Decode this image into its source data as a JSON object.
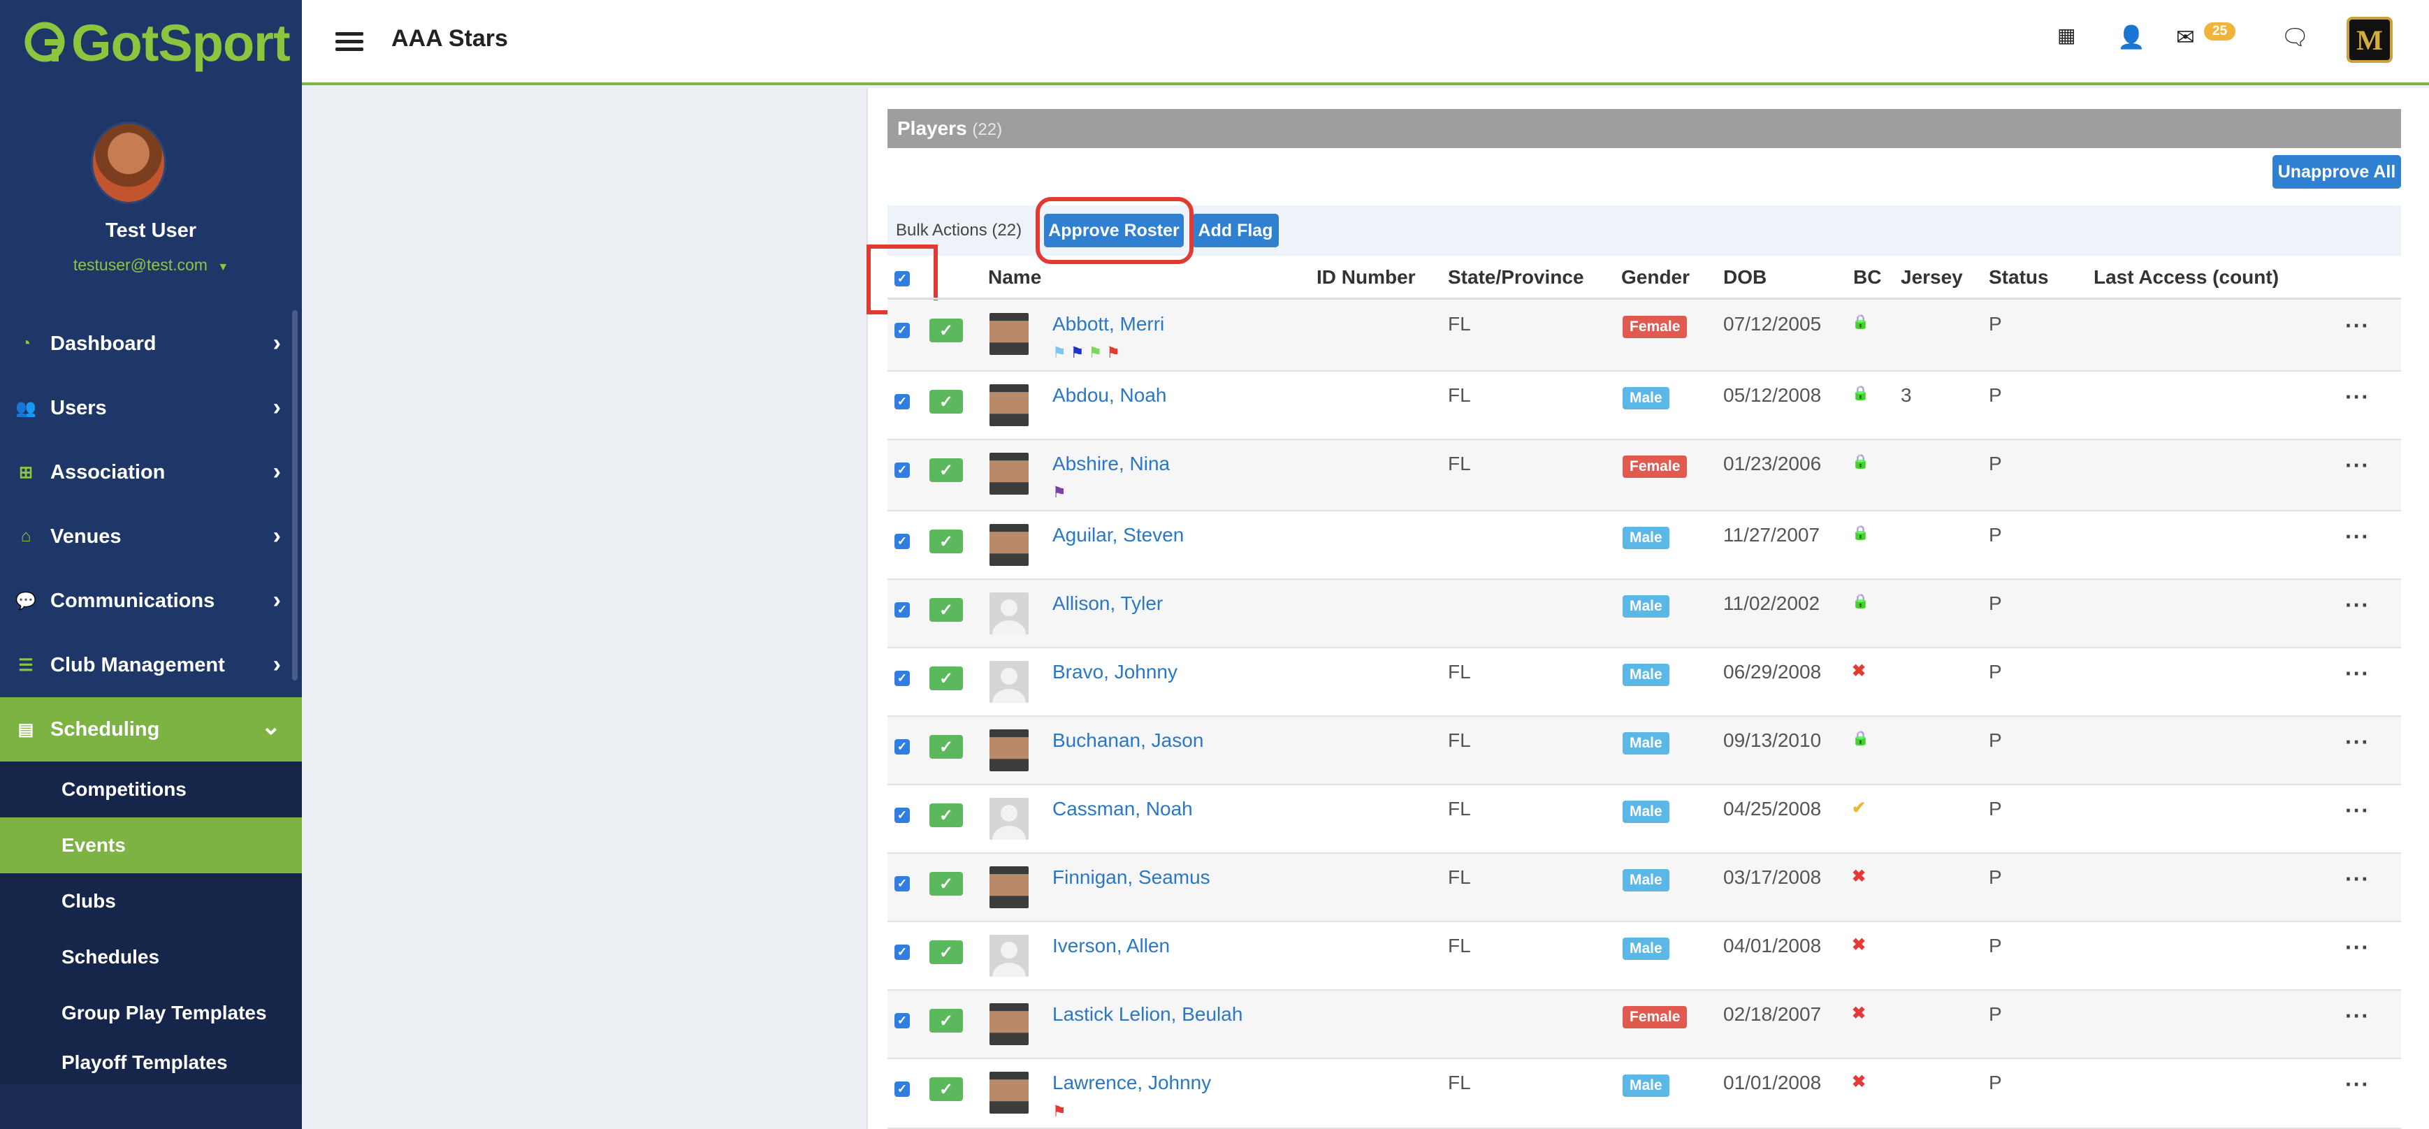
{
  "brand": {
    "logo_text": "GotSport",
    "accent": "#8cc63f",
    "sidebar_bg": "#1e3768"
  },
  "user": {
    "name": "Test User",
    "email": "testuser@test.com"
  },
  "nav": [
    {
      "label": "Dashboard",
      "icon": "dashboard-icon"
    },
    {
      "label": "Users",
      "icon": "users-icon"
    },
    {
      "label": "Association",
      "icon": "sitemap-icon"
    },
    {
      "label": "Venues",
      "icon": "home-icon"
    },
    {
      "label": "Communications",
      "icon": "chat-icon"
    },
    {
      "label": "Club Management",
      "icon": "list-icon"
    },
    {
      "label": "Scheduling",
      "icon": "calendar-list-icon"
    }
  ],
  "subnav": [
    "Competitions",
    "Events",
    "Clubs",
    "Schedules",
    "Group Play Templates",
    "Playoff Templates"
  ],
  "topbar": {
    "team_title": "AAA Stars",
    "mail_count": "25"
  },
  "players": {
    "title": "Players",
    "count": "(22)",
    "unapprove_all": "Unapprove All",
    "bulk_label": "Bulk Actions (22)",
    "approve_roster": "Approve Roster",
    "add_flag": "Add Flag",
    "columns": [
      "Name",
      "ID Number",
      "State/Province",
      "Gender",
      "DOB",
      "BC",
      "Jersey",
      "Status",
      "Last Access (count)"
    ],
    "rows": [
      {
        "name": "Abbott, Merri",
        "state": "FL",
        "gender": "Female",
        "dob": "07/12/2005",
        "bc": "lock",
        "jersey": "",
        "status": "P",
        "flags": [
          "#7fc4ec",
          "#1f2fc9",
          "#7ed957",
          "#e53935"
        ],
        "photo": "photo"
      },
      {
        "name": "Abdou, Noah",
        "state": "FL",
        "gender": "Male",
        "dob": "05/12/2008",
        "bc": "lock",
        "jersey": "3",
        "status": "P",
        "flags": [],
        "photo": "photo"
      },
      {
        "name": "Abshire, Nina",
        "state": "FL",
        "gender": "Female",
        "dob": "01/23/2006",
        "bc": "lock",
        "jersey": "",
        "status": "P",
        "flags": [
          "#7b3fa6"
        ],
        "photo": "photo"
      },
      {
        "name": "Aguilar, Steven",
        "state": "",
        "gender": "Male",
        "dob": "11/27/2007",
        "bc": "lock",
        "jersey": "",
        "status": "P",
        "flags": [],
        "photo": "photo"
      },
      {
        "name": "Allison, Tyler",
        "state": "",
        "gender": "Male",
        "dob": "11/02/2002",
        "bc": "lock",
        "jersey": "",
        "status": "P",
        "flags": [],
        "photo": "placeholder"
      },
      {
        "name": "Bravo, Johnny",
        "state": "FL",
        "gender": "Male",
        "dob": "06/29/2008",
        "bc": "x",
        "jersey": "",
        "status": "P",
        "flags": [],
        "photo": "placeholder"
      },
      {
        "name": "Buchanan, Jason",
        "state": "FL",
        "gender": "Male",
        "dob": "09/13/2010",
        "bc": "lock",
        "jersey": "",
        "status": "P",
        "flags": [],
        "photo": "photo"
      },
      {
        "name": "Cassman, Noah",
        "state": "FL",
        "gender": "Male",
        "dob": "04/25/2008",
        "bc": "check",
        "jersey": "",
        "status": "P",
        "flags": [],
        "photo": "placeholder"
      },
      {
        "name": "Finnigan, Seamus",
        "state": "FL",
        "gender": "Male",
        "dob": "03/17/2008",
        "bc": "x",
        "jersey": "",
        "status": "P",
        "flags": [],
        "photo": "photo"
      },
      {
        "name": "Iverson, Allen",
        "state": "FL",
        "gender": "Male",
        "dob": "04/01/2008",
        "bc": "x",
        "jersey": "",
        "status": "P",
        "flags": [],
        "photo": "placeholder"
      },
      {
        "name": "Lastick Lelion, Beulah",
        "state": "",
        "gender": "Female",
        "dob": "02/18/2007",
        "bc": "x",
        "jersey": "",
        "status": "P",
        "flags": [],
        "photo": "photo"
      },
      {
        "name": "Lawrence, Johnny",
        "state": "FL",
        "gender": "Male",
        "dob": "01/01/2008",
        "bc": "x",
        "jersey": "",
        "status": "P",
        "flags": [
          "#e53935"
        ],
        "photo": "photo"
      }
    ]
  },
  "colors": {
    "female": "#e05a4f",
    "male": "#5bb8e6",
    "lock": "#4caf50",
    "x": "#e53935",
    "check": "#f0b43a",
    "link": "#2a78c5",
    "highlight": "#e13b31"
  }
}
